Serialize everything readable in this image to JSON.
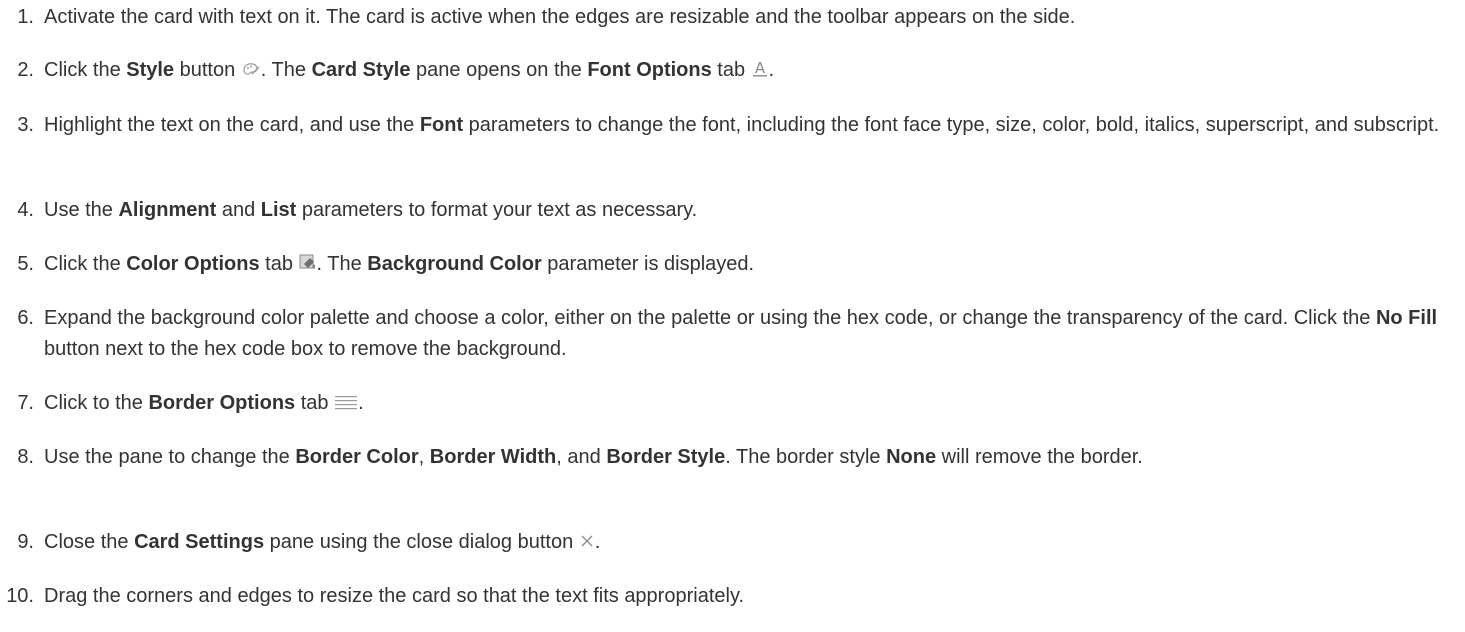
{
  "steps": [
    {
      "number": "1.",
      "parts": [
        {
          "t": "Activate the card with text on it. The card is active when the edges are resizable and the toolbar appears on the side."
        }
      ]
    },
    {
      "number": "2.",
      "parts": [
        {
          "t": "Click the "
        },
        {
          "b": "Style"
        },
        {
          "t": " button "
        },
        {
          "icon": "style-palette-icon"
        },
        {
          "t": ". The "
        },
        {
          "b": "Card Style"
        },
        {
          "t": " pane opens on the "
        },
        {
          "b": "Font Options"
        },
        {
          "t": " tab "
        },
        {
          "icon": "font-options-icon"
        },
        {
          "t": "."
        }
      ]
    },
    {
      "number": "3.",
      "parts": [
        {
          "t": "Highlight the text on the card, and use the "
        },
        {
          "b": "Font"
        },
        {
          "t": " parameters to change the font, including the font face type, size, color, bold, italics, superscript, and subscript."
        }
      ]
    },
    {
      "number": "4.",
      "parts": [
        {
          "t": "Use the "
        },
        {
          "b": "Alignment"
        },
        {
          "t": " and "
        },
        {
          "b": "List"
        },
        {
          "t": " parameters to format your text as necessary."
        }
      ]
    },
    {
      "number": "5.",
      "parts": [
        {
          "t": "Click the "
        },
        {
          "b": "Color Options"
        },
        {
          "t": " tab "
        },
        {
          "icon": "color-options-icon"
        },
        {
          "t": ". The "
        },
        {
          "b": "Background Color"
        },
        {
          "t": " parameter is displayed."
        }
      ]
    },
    {
      "number": "6.",
      "parts": [
        {
          "t": "Expand the background color palette and choose a color, either on the palette or using the hex code, or change the transparency of the card. Click the "
        },
        {
          "b": "No Fill"
        },
        {
          "t": " button next to the hex code box to remove the background."
        }
      ]
    },
    {
      "number": "7.",
      "parts": [
        {
          "t": "Click to the "
        },
        {
          "b": "Border Options"
        },
        {
          "t": " tab "
        },
        {
          "icon": "border-options-icon"
        },
        {
          "t": "."
        }
      ]
    },
    {
      "number": "8.",
      "parts": [
        {
          "t": "Use the pane to change the "
        },
        {
          "b": "Border Color"
        },
        {
          "t": ", "
        },
        {
          "b": "Border Width"
        },
        {
          "t": ", and "
        },
        {
          "b": "Border Style"
        },
        {
          "t": ". The border style "
        },
        {
          "b": "None"
        },
        {
          "t": " will remove the border."
        }
      ]
    },
    {
      "number": "9.",
      "parts": [
        {
          "t": "Close the "
        },
        {
          "b": "Card Settings"
        },
        {
          "t": " pane using the close dialog button "
        },
        {
          "icon": "close-icon"
        },
        {
          "t": "."
        }
      ]
    },
    {
      "number": "10.",
      "parts": [
        {
          "t": "Drag the corners and edges to resize the card so that the text fits appropriately."
        }
      ]
    }
  ]
}
